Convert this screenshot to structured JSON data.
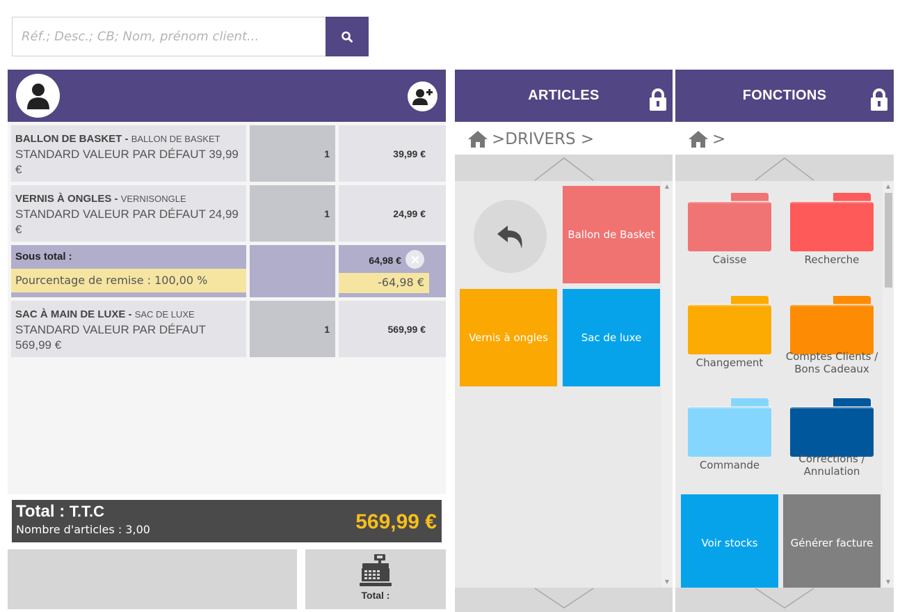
{
  "search": {
    "placeholder": "Réf.; Desc.; CB; Nom, prénom client..."
  },
  "cart": {
    "lines": [
      {
        "name": "BALLON DE BASKET",
        "sep": " - ",
        "ref": "BALLON DE BASKET",
        "variant": "STANDARD VALEUR PAR DÉFAUT 39,99 €",
        "qty": "1",
        "price": "39,99 €"
      },
      {
        "name": "VERNIS À ONGLES",
        "sep": " - ",
        "ref": "VERNISONGLE",
        "variant": "STANDARD VALEUR PAR DÉFAUT 24,99 €",
        "qty": "1",
        "price": "24,99 €"
      },
      {
        "name": "SAC À MAIN DE LUXE",
        "sep": " - ",
        "ref": "SAC DE LUXE",
        "variant": "STANDARD VALEUR PAR DÉFAUT 569,99 €",
        "qty": "1",
        "price": "569,99 €"
      }
    ],
    "subtotal": {
      "label": "Sous total :",
      "value": "64,98 €",
      "discount_label": "Pourcentage de remise : 100,00 %",
      "discount_value": "-64,98 €"
    },
    "total": {
      "label": "Total : ",
      "ttc": "T.T.C",
      "items_count": "Nombre d'articles : 3,00",
      "amount": "569,99 €"
    },
    "pay_label": "Total :"
  },
  "articles": {
    "title": "ARTICLES",
    "breadcrumb": ">DRIVERS >",
    "tiles": [
      {
        "label": "Ballon de Basket",
        "color": "#f07271"
      },
      {
        "label": "Vernis à ongles",
        "color": "#fba802"
      },
      {
        "label": "Sac de luxe",
        "color": "#07a3ea"
      }
    ]
  },
  "fonctions": {
    "title": "FONCTIONS",
    "breadcrumb": ">",
    "folders": [
      {
        "label": "Caisse",
        "color": "#f17474",
        "tab": "#f17474"
      },
      {
        "label": "Recherche",
        "color": "#fe5a5a",
        "tab": "#fe5a5a"
      },
      {
        "label": "Changement",
        "color": "#fcab03",
        "tab": "#fcab03"
      },
      {
        "label": "Comptes Clients / Bons Cadeaux",
        "color": "#fd8c04",
        "tab": "#fd8c04"
      },
      {
        "label": "Commande",
        "color": "#85d6fe",
        "tab": "#85d6fe"
      },
      {
        "label": "Corrections / Annulation",
        "color": "#00579c",
        "tab": "#00579c"
      }
    ],
    "tiles": [
      {
        "label": "Voir stocks",
        "color": "#07a3ea"
      },
      {
        "label": "Générer facture",
        "color": "#808080"
      }
    ]
  },
  "colors": {
    "accent": "#524684",
    "total_amount": "#f8be1a"
  }
}
